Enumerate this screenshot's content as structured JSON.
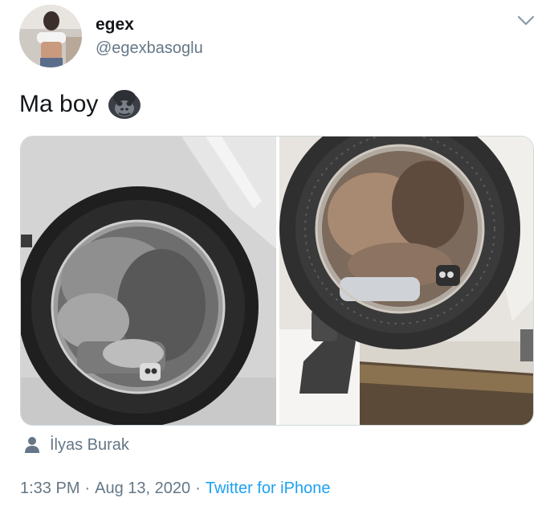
{
  "tweet": {
    "display_name": "egex",
    "handle": "@egexbasoglu",
    "text": "Ma boy",
    "emoji": "gorilla-icon"
  },
  "media": {
    "photos": [
      {
        "name": "mirror-photo-left",
        "tone": "grayscale"
      },
      {
        "name": "mirror-photo-right",
        "tone": "color"
      }
    ]
  },
  "credit": {
    "icon": "person-icon",
    "name": "İlyas Burak"
  },
  "meta": {
    "time": "1:33 PM",
    "separator": "·",
    "date": "Aug 13, 2020",
    "source": "Twitter for iPhone"
  },
  "colors": {
    "text": "#14171a",
    "secondary": "#657786",
    "link": "#1da1f2",
    "border": "#cfd9de"
  }
}
